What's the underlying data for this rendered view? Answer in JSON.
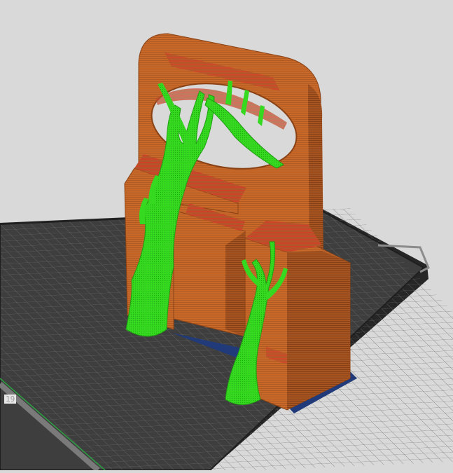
{
  "viewport": {
    "background_color": "#d9d9d9"
  },
  "build_plate": {
    "surface_color": "#3e3e3e",
    "grid_color": "#707070",
    "edge_color": "#1f1f1f",
    "corner_mark": "19",
    "edge_text": ""
  },
  "model": {
    "color": "#c8692a",
    "shade_color": "#9e4e1b",
    "dark_color": "#7a3912",
    "infill_color": "#d73d2a",
    "first_layer_color": "#213a7a"
  },
  "supports": {
    "color": "#35d91f",
    "shade_color": "#1f9e12"
  }
}
